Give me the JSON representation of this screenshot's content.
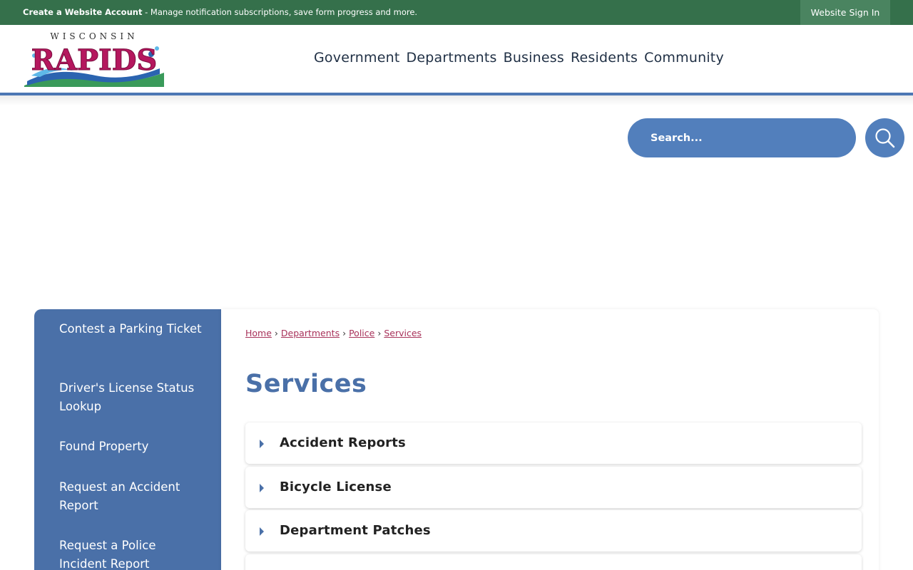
{
  "topbar": {
    "create_account": "Create a Website Account",
    "message": " - Manage notification subscriptions, save form progress and more.",
    "sign_in": "Website Sign In"
  },
  "logo": {
    "top_text": "WISCONSIN",
    "main_text": "RAPIDS"
  },
  "nav": {
    "items": [
      "Government",
      "Departments",
      "Business",
      "Residents",
      "Community"
    ]
  },
  "search": {
    "placeholder": "Search..."
  },
  "sidebar": {
    "items": [
      "Contest a Parking Ticket",
      "Driver's License Status Lookup",
      "Found Property",
      "Request an Accident Report",
      "Request a Police Incident Report"
    ]
  },
  "breadcrumb": [
    "Home",
    "Departments",
    "Police",
    "Services"
  ],
  "page": {
    "title": "Services"
  },
  "accordion": {
    "items": [
      "Accident Reports",
      "Bicycle License",
      "Department Patches"
    ]
  },
  "colors": {
    "topbar": "#35704b",
    "accent_blue": "#4a70a8",
    "search_blue": "#527fbc",
    "link": "#a8325a"
  }
}
